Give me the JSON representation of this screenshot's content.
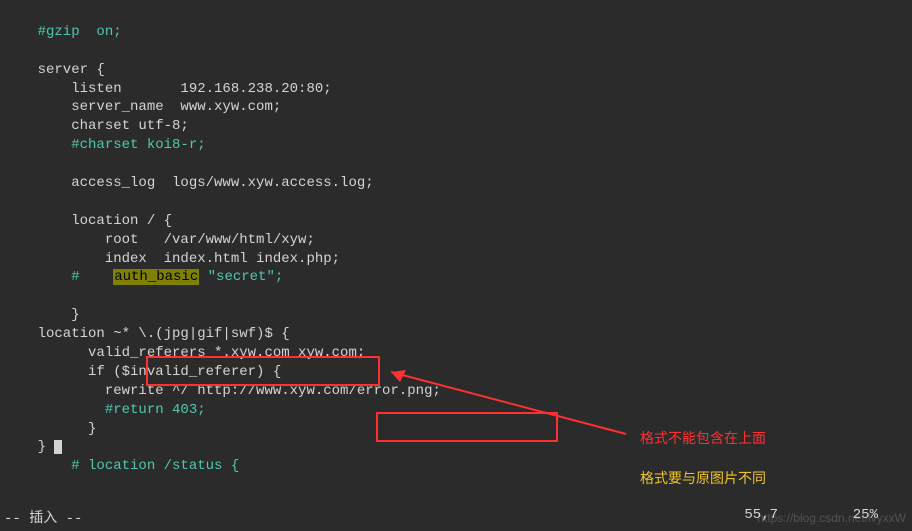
{
  "code": {
    "l1": "    #gzip  on;",
    "l2": "",
    "l3": "    server {",
    "l4": "        listen       192.168.238.20:80;",
    "l5": "        server_name  www.xyw.com;",
    "l6": "        charset utf-8;",
    "l7": "        #charset koi8-r;",
    "l8": "",
    "l9": "        access_log  logs/www.xyw.access.log;",
    "l10": "",
    "l11": "        location / {",
    "l12": "            root   /var/www/html/xyw;",
    "l13": "            index  index.html index.php;",
    "l14_prefix": "        #    ",
    "l14_hl": "auth_basic",
    "l14_suffix": " \"secret\";",
    "l15": "",
    "l16": "        }",
    "l17": "    location ~* \\.(jpg|gif|swf)$ {",
    "l18": "          valid_referers *.xyw.com xyw.com;",
    "l19": "          if ($invalid_referer) {",
    "l20": "            rewrite ^/ http://www.xyw.com/error.png;",
    "l21": "            #return 403;",
    "l22": "          }",
    "l23": "    } ",
    "l24": "        # location /status {"
  },
  "annotations": {
    "red": "格式不能包含在上面",
    "yellow": "格式要与原图片不同"
  },
  "status": {
    "mode": "-- 插入 --",
    "position": "55,7",
    "percent": "25%"
  },
  "watermark": "https://blog.csdn.net/lvyxxW"
}
